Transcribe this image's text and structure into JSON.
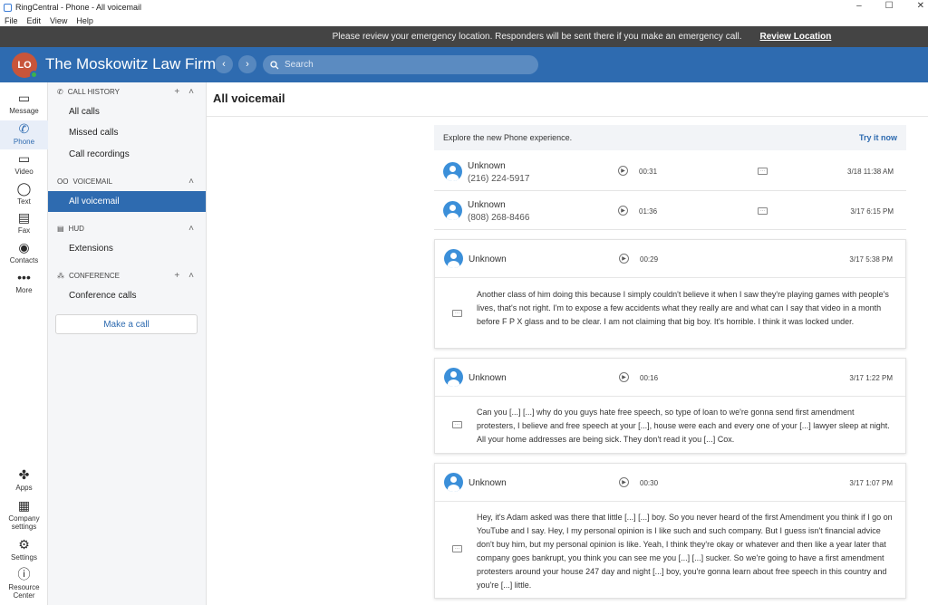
{
  "window": {
    "title": "RingCentral - Phone - All voicemail",
    "menus": [
      "File",
      "Edit",
      "View",
      "Help"
    ]
  },
  "banner": {
    "message": "Please review your emergency location. Responders will be sent there if you make an emergency call.",
    "link": "Review Location"
  },
  "header": {
    "initials": "LO",
    "firm": "The Moskowitz Law Firm",
    "search_placeholder": "Search"
  },
  "rail": [
    {
      "label": "Message",
      "icon": "message-icon"
    },
    {
      "label": "Phone",
      "icon": "phone-icon",
      "active": true
    },
    {
      "label": "Video",
      "icon": "video-icon"
    },
    {
      "label": "Text",
      "icon": "text-icon"
    },
    {
      "label": "Fax",
      "icon": "fax-icon"
    },
    {
      "label": "Contacts",
      "icon": "contacts-icon"
    },
    {
      "label": "More",
      "icon": "more-icon"
    }
  ],
  "rail_bottom": [
    {
      "label": "Apps",
      "icon": "apps-icon"
    },
    {
      "label": "Company settings",
      "icon": "company-settings-icon"
    },
    {
      "label": "Settings",
      "icon": "settings-icon"
    },
    {
      "label": "Resource Center",
      "icon": "help-icon"
    }
  ],
  "nav": {
    "call_history": {
      "title": "CALL HISTORY",
      "items": [
        "All calls",
        "Missed calls",
        "Call recordings"
      ]
    },
    "voicemail": {
      "title": "VOICEMAIL",
      "items": [
        "All voicemail"
      ]
    },
    "hud": {
      "title": "HUD",
      "items": [
        "Extensions"
      ]
    },
    "conference": {
      "title": "CONFERENCE",
      "items": [
        "Conference calls"
      ]
    },
    "make_call": "Make a call"
  },
  "main": {
    "title": "All voicemail",
    "explore": {
      "text": "Explore the new Phone experience.",
      "link": "Try it now"
    },
    "rows": [
      {
        "name": "Unknown",
        "number": "(216) 224-5917",
        "duration": "00:31",
        "date": "3/18 11:38 AM"
      },
      {
        "name": "Unknown",
        "number": "(808) 268-8466",
        "duration": "01:36",
        "date": "3/17 6:15 PM"
      }
    ],
    "cards": [
      {
        "name": "Unknown",
        "duration": "00:29",
        "date": "3/17 5:38 PM",
        "transcript": "Another class of him doing this because I simply couldn't believe it when I saw they're playing games with people's lives, that's not right. I'm to expose a few accidents what they really are and what can I say that video in a month before F P X glass and to be clear. I am not claiming that big boy. It's horrible. I think it was locked under."
      },
      {
        "name": "Unknown",
        "duration": "00:16",
        "date": "3/17 1:22 PM",
        "transcript": "Can you [...] [...] why do you guys hate free speech, so type of loan to we're gonna send first amendment protesters, I believe and free speech at your [...], house were each and every one of your [...] lawyer sleep at night. All your home addresses are being sick. They don't read it you [...] Cox."
      },
      {
        "name": "Unknown",
        "duration": "00:30",
        "date": "3/17 1:07 PM",
        "transcript": "Hey, it's Adam asked was there that little [...] [...] boy. So you never heard of the first Amendment you think if I go on YouTube and I say. Hey, I my personal opinion is I like such and such company. But I guess isn't financial advice don't buy him, but my personal opinion is like. Yeah, I think they're okay or whatever and then like a year later that company goes bankrupt, you think you can see me you [...] [...] sucker. So we're going to have a first amendment protesters around your house 247 day and night [...] boy, you're gonna learn about free speech in this country and you're [...] little."
      }
    ]
  },
  "colors": {
    "brand": "#2e6bb0",
    "banner": "#444444",
    "avatar": "#c8553a",
    "presence": "#3cb34a"
  }
}
